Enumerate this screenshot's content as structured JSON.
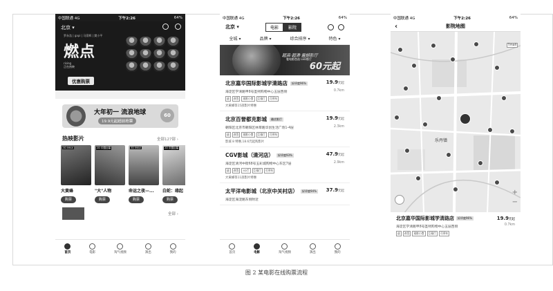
{
  "caption": "图 2 某电影在线购票流程",
  "status": {
    "carrier": "中国联通",
    "network": "4G",
    "time": "下午2:26",
    "battery": "64%"
  },
  "phone1": {
    "city": "北京",
    "hero": {
      "staff_line": "罗永浩 | gapi | 马家辉 | 樊小平",
      "title": "燃点",
      "subtitle_en": "rising",
      "subtitle": "正在热映",
      "buy_label": "优惠购票"
    },
    "banner": {
      "headline": "大年初一 流浪地球",
      "offer": "19.9元起超前抢票",
      "countdown": "60"
    },
    "section_now_showing": {
      "title": "热映影片",
      "more": "全部127部"
    },
    "movies": [
      {
        "tag": "3D IMAX",
        "name": "大黄蜂",
        "buy": "购票"
      },
      {
        "tag": "2D 中国巨幕",
        "name": "\"大\"人物",
        "buy": "购票"
      },
      {
        "tag": "3D IMAX",
        "name": "命运之夜—...",
        "buy": "购票"
      },
      {
        "tag": "2D 中国巨幕",
        "name": "白蛇：缘起",
        "buy": "购票"
      }
    ],
    "more_section": {
      "thumb": "影院",
      "more": "全部"
    },
    "tabs": [
      {
        "label": "首页",
        "icon": "home-icon"
      },
      {
        "label": "电影",
        "icon": "film-icon"
      },
      {
        "label": "淘气视频",
        "icon": "video-icon"
      },
      {
        "label": "演出",
        "icon": "ticket-icon"
      },
      {
        "label": "我的",
        "icon": "user-icon"
      }
    ]
  },
  "phone2": {
    "city": "北京",
    "segments": [
      "电影",
      "影院"
    ],
    "filters": [
      "全城",
      "品牌",
      "综合排序",
      "特色"
    ],
    "ad": {
      "line1": "超高·超清·震撼影厅",
      "line2": "看电影首选 LED影厅",
      "price": "60元起"
    },
    "cinemas": [
      {
        "name": "北京嘉华国际影城学清路店",
        "badge": "好评度96%",
        "price": "19.9",
        "price_unit": "元起",
        "address": "海淀区学清路甲8号圣熙购物中心五层西侧",
        "distance": "0.7km",
        "tags": [
          "退",
          "改签",
          "观影小食",
          "巨幕厅",
          "可停车"
        ],
        "note": "大黄蜂等15部影片特惠"
      },
      {
        "name": "北京百誉都克影城",
        "badge": "最优影厅",
        "price": "19.9",
        "price_unit": "元起",
        "address": "朝阳区北京市朝阳区林萃路华创生活广场1-4层",
        "distance": "2.3km",
        "tags": [
          "退",
          "改签",
          "观影小食",
          "巨幕厅",
          "可停车"
        ],
        "note": "影城 8 特惠,18.6元起购影片"
      },
      {
        "name": "CGV影城（清河店）",
        "badge": "好评度93%",
        "price": "47.9",
        "price_unit": "元起",
        "address": "海淀区清河中街68号五彩城购物中心东区7层",
        "distance": "2.9km",
        "tags": [
          "退",
          "改签",
          "4D厅",
          "巨幕厅",
          "可停车"
        ],
        "note": "大黄蜂等11部影片特惠"
      },
      {
        "name": "太平洋电影城（北京中关村店）",
        "badge": "好评度94%",
        "price": "37.9",
        "price_unit": "元起",
        "address": "海淀区海淀路东侧附近",
        "distance": "",
        "tags": [],
        "note": ""
      }
    ],
    "tabs": [
      {
        "label": "首页",
        "icon": "home-icon"
      },
      {
        "label": "电影",
        "icon": "film-icon"
      },
      {
        "label": "淘气视频",
        "icon": "video-icon"
      },
      {
        "label": "演出",
        "icon": "ticket-icon"
      },
      {
        "label": "我的",
        "icon": "user-icon"
      }
    ]
  },
  "phone3": {
    "title": "影院地图",
    "map_label": "乐丹镇",
    "map_logo": "Tmall",
    "cinema": {
      "name": "北京嘉华国际影城学清路店",
      "badge": "好评度96%",
      "price": "19.9",
      "price_unit": "元起",
      "address": "海淀区学清路甲8号圣熙购物中心五层西侧",
      "distance": "0.7km",
      "tags": [
        "退",
        "改签",
        "观影小食",
        "巨幕厅",
        "可停车"
      ]
    }
  }
}
